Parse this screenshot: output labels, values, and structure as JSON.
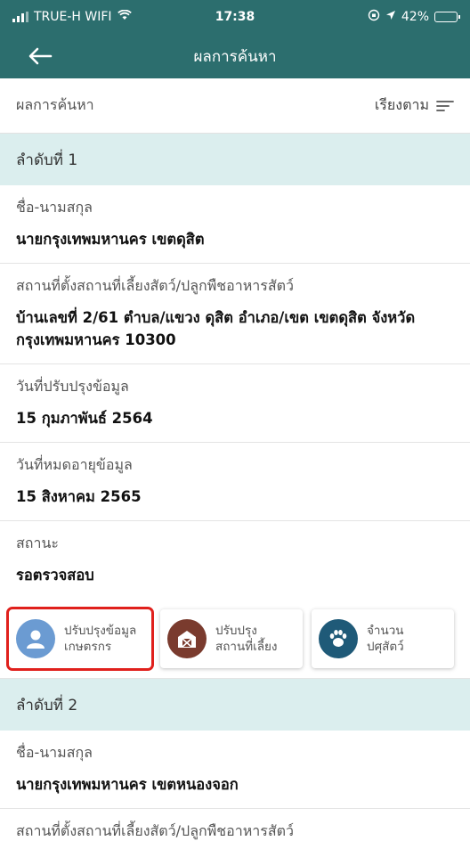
{
  "status_bar": {
    "carrier": "TRUE-H WIFI",
    "time": "17:38",
    "battery": "42%",
    "battery_level": 0.42
  },
  "nav": {
    "title": "ผลการค้นหา"
  },
  "result_header": {
    "title": "ผลการค้นหา",
    "sort_label": "เรียงตาม"
  },
  "records": [
    {
      "heading": "ลำดับที่ 1",
      "name_label": "ชื่อ-นามสกุล",
      "name": "นายกรุงเทพมหานคร เขตดุสิต",
      "location_label": "สถานที่ตั้งสถานที่เลี้ยงสัตว์/ปลูกพืชอาหารสัตว์",
      "location": "บ้านเลขที่ 2/61  ตำบล/แขวง ดุสิต อำเภอ/เขต เขตดุสิต จังหวัด กรุงเทพมหานคร 10300",
      "updated_label": "วันที่ปรับปรุงข้อมูล",
      "updated": "15 กุมภาพันธ์ 2564",
      "expiry_label": "วันที่หมดอายุข้อมูล",
      "expiry": "15 สิงหาคม 2565",
      "status_label": "สถานะ",
      "status": "รอตรวจสอบ"
    },
    {
      "heading": "ลำดับที่ 2",
      "name_label": "ชื่อ-นามสกุล",
      "name": "นายกรุงเทพมหานคร เขตหนองจอก",
      "location_label": "สถานที่ตั้งสถานที่เลี้ยงสัตว์/ปลูกพืชอาหารสัตว์"
    }
  ],
  "actions": [
    {
      "line1": "ปรับปรุงข้อมูล",
      "line2": "เกษตรกร",
      "icon": "farmer-person-icon",
      "color": "#6b9bd2"
    },
    {
      "line1": "ปรับปรุง",
      "line2": "สถานที่เลี้ยง",
      "icon": "barn-icon",
      "color": "#7a3b2e"
    },
    {
      "line1": "จำนวน",
      "line2": "ปศุสัตว์",
      "icon": "paw-icon",
      "color": "#1f5a78"
    }
  ],
  "colors": {
    "header": "#2c6e6e",
    "section": "#dbeeee",
    "highlight": "#e0201c"
  }
}
